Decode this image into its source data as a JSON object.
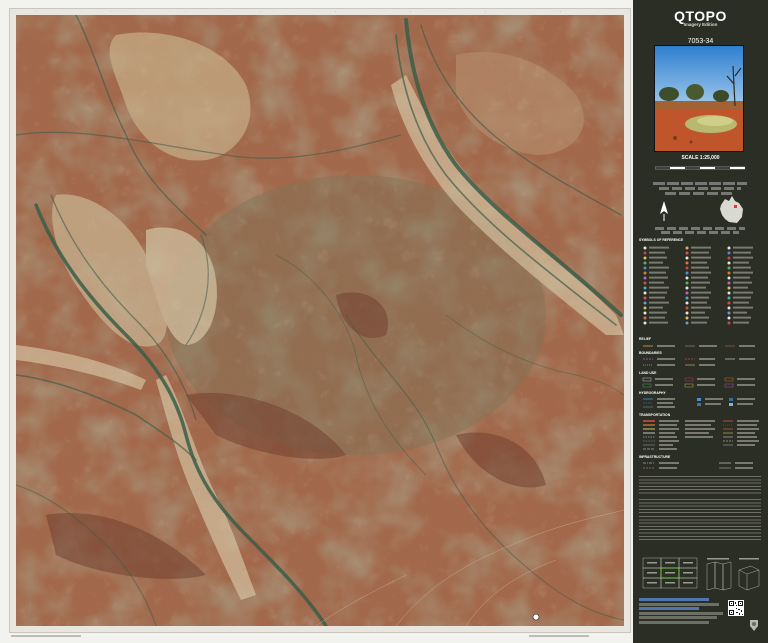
{
  "brand": {
    "title": "QTOPO",
    "subtitle": "Imagery Edition"
  },
  "sheet": {
    "number": "7053-34",
    "scale_label": "SCALE 1:25,000"
  },
  "legend": {
    "reference_heading": "SYMBOLS OF REFERENCE",
    "relief_heading": "RELIEF",
    "boundaries_heading": "BOUNDARIES",
    "land_use_heading": "LAND USE",
    "hydrography_heading": "HYDROGRAPHY",
    "transportation_heading": "TRANSPORTATION",
    "infrastructure_heading": "INFRASTRUCTURE"
  },
  "colors": {
    "panel_bg": "#2b2e25",
    "map_soil": "#a3674a",
    "map_river": "#2f5a45",
    "map_sand": "#d8c8a8",
    "map_green": "#5f7a56"
  },
  "icons": [
    "qr-code-icon",
    "queensland-crest-icon",
    "australia-locator-icon"
  ]
}
